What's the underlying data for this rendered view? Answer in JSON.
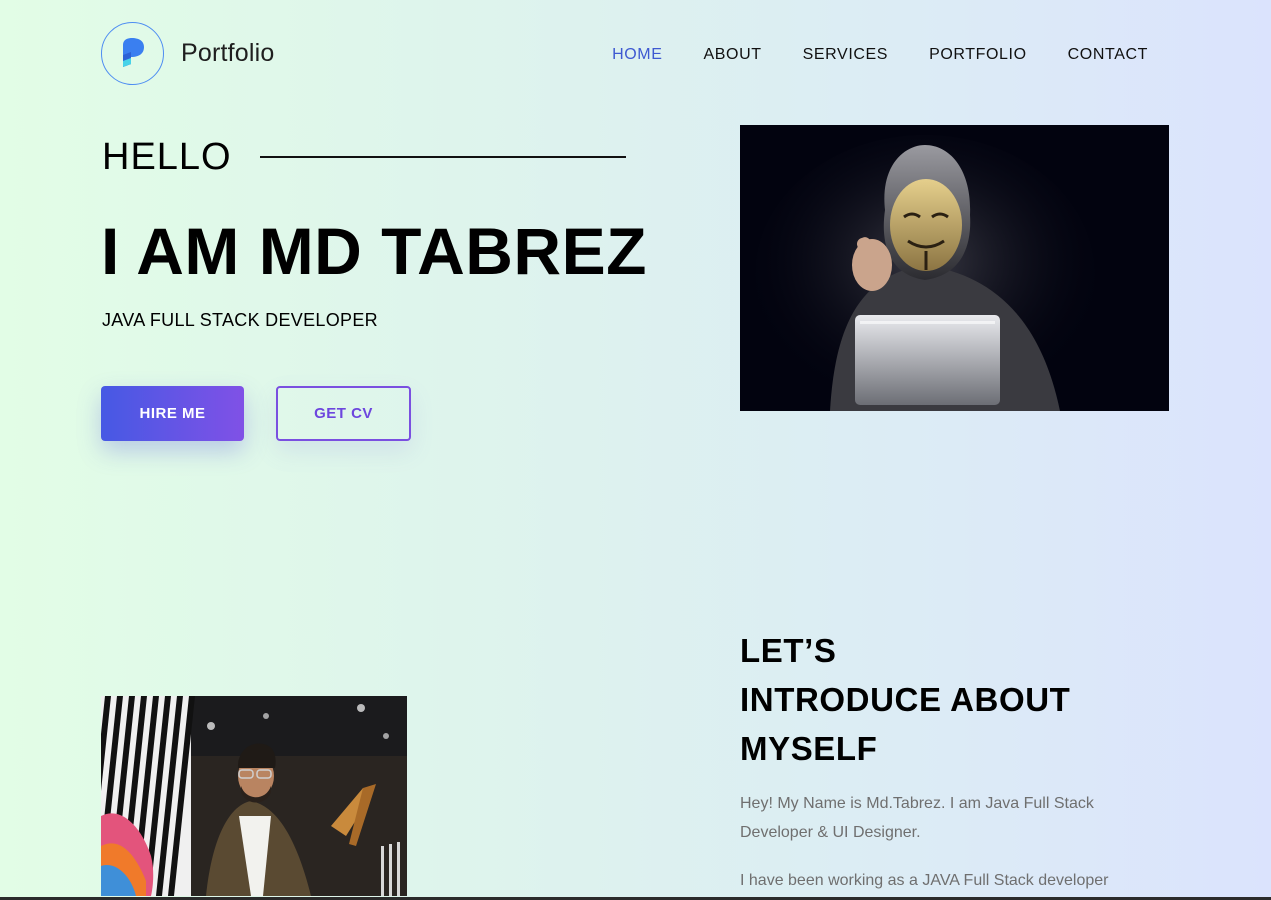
{
  "brand": {
    "name": "Portfolio",
    "logo_icon": "p-logo-icon",
    "accent": "#3e59d1"
  },
  "nav": {
    "items": [
      {
        "label": "HOME",
        "active": true
      },
      {
        "label": "ABOUT",
        "active": false
      },
      {
        "label": "SERVICES",
        "active": false
      },
      {
        "label": "PORTFOLIO",
        "active": false
      },
      {
        "label": "CONTACT",
        "active": false
      }
    ]
  },
  "hero": {
    "greeting": "HELLO",
    "name": "I AM MD TABREZ",
    "role": "JAVA FULL STACK DEVELOPER",
    "hire_button": "HIRE ME",
    "cv_button": "GET CV",
    "hire_gradient": [
      "#4659e4",
      "#8051e6"
    ]
  },
  "about": {
    "heading_lines": [
      "LET’S",
      "INTRODUCE ABOUT",
      "MYSELF"
    ],
    "paragraph_1": "Hey! My Name is Md.Tabrez. I am Java Full Stack Developer & UI Designer.",
    "paragraph_2": "I have been working as a JAVA Full Stack developer"
  }
}
